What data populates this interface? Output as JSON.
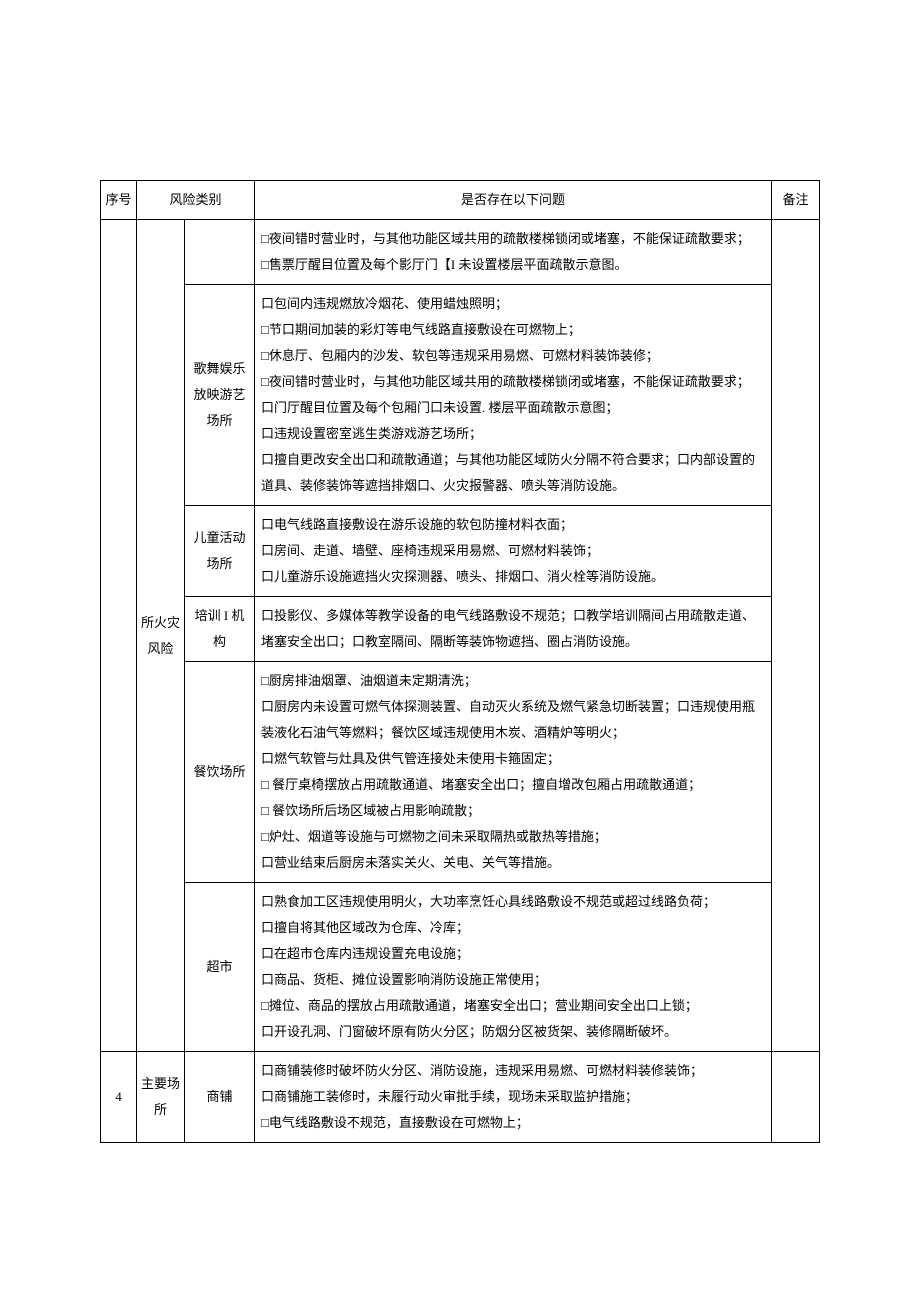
{
  "headers": {
    "seq": "序号",
    "category": "风险类别",
    "issue": "是否存在以下问题",
    "note": "备注"
  },
  "rows": [
    {
      "seq": "",
      "cat1": "所火灾风险",
      "sub": [
        {
          "cat2": "",
          "issue": "□夜间错时营业时，与其他功能区域共用的疏散楼梯锁闭或堵塞，不能保证疏散要求；\n□售票厅醒目位置及每个影厅门【I 未设置楼层平面疏散示意图。"
        },
        {
          "cat2": "歌舞娱乐放映游艺场所",
          "issue": "口包间内违规燃放冷烟花、使用蜡烛照明；\n□节口期间加装的彩灯等电气线路直接敷设在可燃物上；\n□休息厅、包厢内的沙发、软包等违规采用易燃、可燃材料装饰装修；\n□夜间错时营业时，与其他功能区域共用的疏散楼梯锁闭或堵塞，不能保证疏散要求；\n口门厅醒目位置及每个包厢门口未设置. 楼层平面疏散示意图；\n口违规设置密室逃生类游戏游艺场所；\n口擅自更改安全出口和疏散通道；与其他功能区域防火分隔不符合要求；口内部设置的道具、装修装饰等遮挡排烟口、火灾报警器、喷头等消防设施。"
        },
        {
          "cat2": "儿童活动场所",
          "issue": "口电气线路直接敷设在游乐设施的软包防撞材料衣面；\n口房间、走道、墙壁、座椅违规采用易燃、可燃材料装饰；\n口儿童游乐设施遮挡火灾探测器、喷头、排烟口、消火栓等消防设施。"
        },
        {
          "cat2": "培训 I 机构",
          "issue": "口投影仪、多媒体等教学设备的电气线路敷设不规范；口教学培训隔间占用疏散走道、堵塞安全出口；口教室隔间、隔断等装饰物遮挡、圈占消防设施。"
        },
        {
          "cat2": "餐饮场所",
          "issue": "□厨房排油烟罩、油烟道未定期清洗；\n口厨房内未设置可燃气体探测装置、自动灭火系统及燃气紧急切断装置；口违规使用瓶装液化石油气等燃料；餐饮区域违规使用木炭、酒精炉等明火；\n口燃气软管与灶具及供气管连接处未使用卡箍固定；\n□ 餐厅桌椅摆放占用疏散通道、堵塞安全出口；擅自增改包厢占用疏散通道；\n□ 餐饮场所后场区域被占用影响疏散；\n□炉灶、烟道等设施与可燃物之间未采取隔热或散热等措施；\n口营业结束后厨房未落实关火、关电、关气等措施。"
        },
        {
          "cat2": "超市",
          "issue": "口熟食加工区违规使用明火，大功率烹饪心具线路敷设不规范或超过线路负荷；\n口擅自将其他区域改为仓库、冷库；\n口在超市仓库内违规设置充电设施；\n口商品、货柜、摊位设置影响消防设施正常使用；\n□摊位、商品的摆放占用疏散通道，堵塞安全出口；营业期间安全出口上锁；\n口开设孔洞、门窗破坏原有防火分区；防烟分区被货架、装修隔断破坏。"
        }
      ]
    },
    {
      "seq": "4",
      "cat1": "主要场所",
      "sub": [
        {
          "cat2": "商铺",
          "issue": "口商铺装修时破坏防火分区、消防设施，违规采用易燃、可燃材料装修装饰；\n口商铺施工装修时，未履行动火审批手续，现场未采取监护措施；\n□电气线路敷设不规范，直接敷设在可燃物上；"
        }
      ]
    }
  ]
}
